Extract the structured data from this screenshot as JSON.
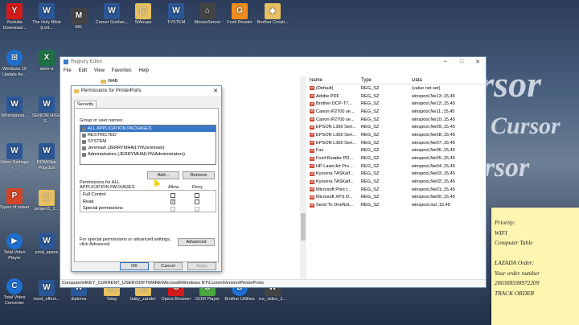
{
  "desktop": {
    "watermark": [
      "Cursor",
      "Cursor",
      "Cursor"
    ],
    "icons": [
      {
        "label": "Youtube Download...",
        "kind": "pdf",
        "glyph": "Y"
      },
      {
        "label": "The Holy Bible (Lett...",
        "kind": "word",
        "glyph": "W"
      },
      {
        "label": "MIL",
        "kind": "dark",
        "glyph": "M"
      },
      {
        "label": "Career Guidan...",
        "kind": "word",
        "glyph": "W"
      },
      {
        "label": "StAnupe",
        "kind": "folder",
        "glyph": "▢"
      },
      {
        "label": "TVSTEM",
        "kind": "word",
        "glyph": "W"
      },
      {
        "label": "MouseServer",
        "kind": "dark",
        "glyph": "⌂"
      },
      {
        "label": "Foxit Reader",
        "kind": "orange",
        "glyph": "G"
      },
      {
        "label": "Brother Creati...",
        "kind": "folder",
        "glyph": "◆"
      },
      {
        "label": "Windows 10 Update As...",
        "kind": "media",
        "glyph": "⊞"
      },
      {
        "label": "stem-a",
        "kind": "excel",
        "glyph": "X"
      },
      {
        "label": "Whenipress...",
        "kind": "word",
        "glyph": "W"
      },
      {
        "label": "SENIOR HIGH S...",
        "kind": "word",
        "glyph": "W"
      },
      {
        "label": "Video Settings -...",
        "kind": "word",
        "glyph": "W"
      },
      {
        "label": "ROM/Star Playclub",
        "kind": "word",
        "glyph": "W"
      },
      {
        "label": "Types of power",
        "kind": "ppt",
        "glyph": "P"
      },
      {
        "label": "project1_2...",
        "kind": "folder",
        "glyph": "▢"
      },
      {
        "label": "Total Video Player",
        "kind": "media",
        "glyph": "▶"
      },
      {
        "label": "prod_epsos",
        "kind": "word",
        "glyph": "W"
      },
      {
        "label": "Total Video Converter",
        "kind": "media",
        "glyph": "C"
      },
      {
        "label": "most_effect...",
        "kind": "word",
        "glyph": "W"
      },
      {
        "label": "diploma",
        "kind": "word",
        "glyph": "W"
      },
      {
        "label": "Tatay",
        "kind": "folder",
        "glyph": "▢"
      },
      {
        "label": "baby_zander",
        "kind": "folder",
        "glyph": "▢"
      },
      {
        "label": "Opera Browser",
        "kind": "pdf",
        "glyph": "O"
      },
      {
        "label": "GOM Player",
        "kind": "game",
        "glyph": "G"
      },
      {
        "label": "Brother Utilities",
        "kind": "media",
        "glyph": "B"
      },
      {
        "label": "ice_video_2...",
        "kind": "dark",
        "glyph": "W"
      }
    ]
  },
  "regedit": {
    "title": "Registry Editor",
    "window_controls": [
      "–",
      "□",
      "✕"
    ],
    "menu": [
      "File",
      "Edit",
      "View",
      "Favorites",
      "Help"
    ],
    "tree_item": "WAB",
    "columns": [
      "Name",
      "Type",
      "Data"
    ],
    "rows": [
      {
        "name": "(Default)",
        "type": "REG_SZ",
        "data": "(value not set)"
      },
      {
        "name": "Adobe PDF",
        "type": "REG_SZ",
        "data": "winspool,Ne13:,15,45"
      },
      {
        "name": "Brother DCP-T7...",
        "type": "REG_SZ",
        "data": "winspool,Ne12:,15,45"
      },
      {
        "name": "Canon iP2700 se...",
        "type": "REG_SZ",
        "data": "winspool,Ne11:,15,45"
      },
      {
        "name": "Canon iP2700 se...",
        "type": "REG_SZ",
        "data": "winspool,Ne10:,15,45"
      },
      {
        "name": "EPSON L360 Seri...",
        "type": "REG_SZ",
        "data": "winspool,Ne09:,15,45"
      },
      {
        "name": "EPSON L360 Seri...",
        "type": "REG_SZ",
        "data": "winspool,Ne08:,15,45"
      },
      {
        "name": "EPSON L360 Seri...",
        "type": "REG_SZ",
        "data": "winspool,Ne07:,15,45"
      },
      {
        "name": "Fax",
        "type": "REG_SZ",
        "data": "winspool,Ne06:,15,45"
      },
      {
        "name": "Foxit Reader PD...",
        "type": "REG_SZ",
        "data": "winspool,Ne05:,15,45"
      },
      {
        "name": "HP LaserJet Pro ...",
        "type": "REG_SZ",
        "data": "winspool,Ne04:,15,45"
      },
      {
        "name": "Kyocera TASKalf...",
        "type": "REG_SZ",
        "data": "winspool,Ne03:,15,45"
      },
      {
        "name": "Kyocera TASKalf...",
        "type": "REG_SZ",
        "data": "winspool,Ne02:,15,45"
      },
      {
        "name": "Microsoft Print t...",
        "type": "REG_SZ",
        "data": "winspool,Ne01:,15,45"
      },
      {
        "name": "Microsoft XPS D...",
        "type": "REG_SZ",
        "data": "winspool,Ne00:,15,45"
      },
      {
        "name": "Send To OneNot...",
        "type": "REG_SZ",
        "data": "winspool,nul:,15,45"
      }
    ],
    "status_path": "Computer\\HKEY_CURRENT_USER\\SOFTWARE\\Microsoft\\Windows NT\\CurrentVersion\\PrinterPorts"
  },
  "permissions": {
    "title": "Permissions for PrinterPorts",
    "tab": "Security",
    "group_label": "Group or user names:",
    "users": [
      {
        "name": "ALL APPLICATION PACKAGES",
        "selected": true
      },
      {
        "name": "RESTRICTED",
        "selected": false
      },
      {
        "name": "SYSTEM",
        "selected": false
      },
      {
        "name": "Jeremiah (JERRYMHAILYN\\Jeremiah)",
        "selected": false
      },
      {
        "name": "Administrators (JERRYMHAILYN\\Administrators)",
        "selected": false
      }
    ],
    "add_label": "Add...",
    "remove_label": "Remove",
    "perm_for_label_1": "Permissions for ALL",
    "perm_for_label_2": "APPLICATION PACKAGES",
    "allow_label": "Allow",
    "deny_label": "Deny",
    "perms": [
      {
        "name": "Full Control",
        "allow": false,
        "deny": false,
        "disabled": false
      },
      {
        "name": "Read",
        "allow": true,
        "deny": false,
        "disabled": false
      },
      {
        "name": "Special permissions",
        "allow": false,
        "deny": false,
        "disabled": true
      }
    ],
    "advanced_text_1": "For special permissions or advanced settings,",
    "advanced_text_2": "click Advanced.",
    "advanced_label": "Advanced",
    "ok_label": "OK",
    "cancel_label": "Cancel",
    "apply_label": "Apply"
  },
  "sticky": {
    "lines": [
      "Priority:",
      "WIFI",
      "Computer Table",
      "",
      "LAZADA Order:",
      "Your order number",
      "200308598972209",
      "TRACK ORDER"
    ]
  }
}
